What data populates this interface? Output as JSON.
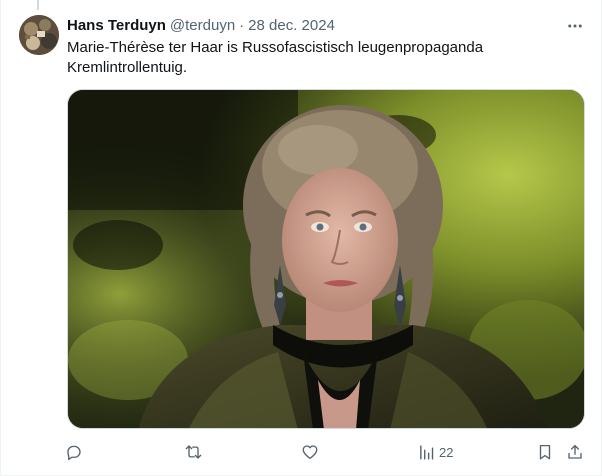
{
  "tweet": {
    "author_name": "Hans Terduyn",
    "handle": "@terduyn",
    "separator": "·",
    "date": "28 dec. 2024",
    "text": "Marie-Thérèse ter Haar is Russofascistisch leugenpropaganda Kremlintrollentuig.",
    "avatar_icon": "avatar-image",
    "more_icon": "more-horizontal-icon",
    "media_description_icon": "photo-woman-dark-background"
  },
  "actions": {
    "reply_icon": "reply-icon",
    "retweet_icon": "retweet-icon",
    "like_icon": "like-heart-icon",
    "views_icon": "views-bar-chart-icon",
    "views_count": "22",
    "bookmark_icon": "bookmark-icon",
    "share_icon": "share-icon"
  },
  "colors": {
    "text_primary": "#0f1419",
    "text_secondary": "#536471",
    "border": "#cfd9de"
  }
}
